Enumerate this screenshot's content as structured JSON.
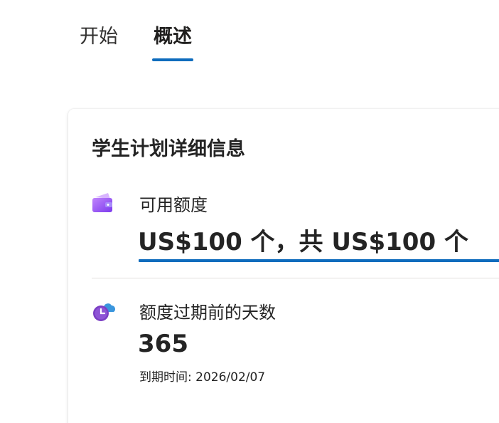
{
  "tabs": [
    {
      "label": "开始",
      "active": false
    },
    {
      "label": "概述",
      "active": true
    }
  ],
  "card": {
    "title": "学生计划详细信息",
    "credit": {
      "icon": "wallet-icon",
      "label": "可用额度",
      "value": "US$100 个，共 US$100 个"
    },
    "days": {
      "icon": "cloud-clock-icon",
      "label": "额度过期前的天数",
      "value": "365",
      "expiry": "到期时间: 2026/02/07"
    }
  },
  "colors": {
    "accent": "#0f6cbd",
    "wallet": "#8b5cf6",
    "clock": "#7b3fc4",
    "cloud": "#3a96dd"
  }
}
